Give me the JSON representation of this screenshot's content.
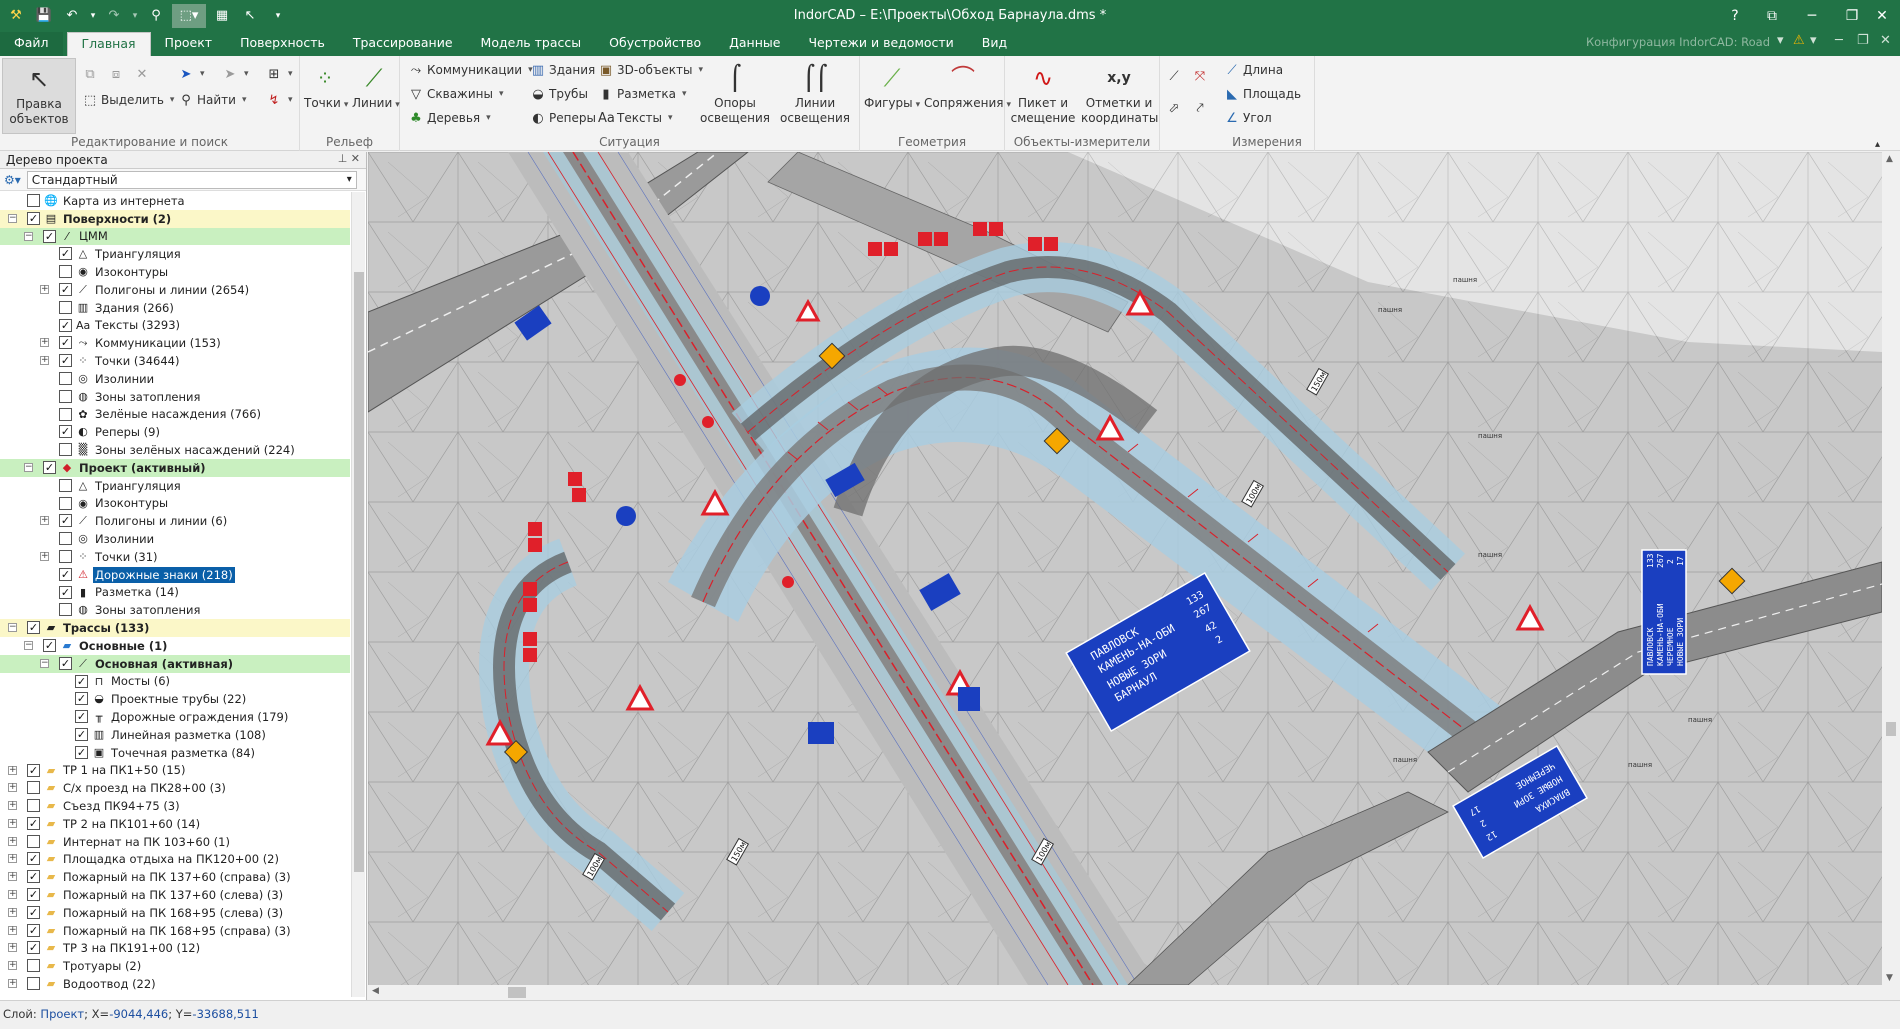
{
  "window": {
    "title": "IndorCAD – E:\\Проекты\\Обход Барнаула.dms *",
    "help": "?",
    "controls": [
      "⧉",
      "─",
      "❐",
      "✕"
    ]
  },
  "quick_access": {
    "icons": [
      "app-logo-icon",
      "save-icon",
      "undo-icon",
      "redo-icon",
      "zoom-tool-icon",
      "select-mode-icon",
      "layout-icon",
      "pointer-icon",
      "customize-icon"
    ]
  },
  "menu": {
    "tabs": [
      "Файл",
      "Главная",
      "Проект",
      "Поверхность",
      "Трассирование",
      "Модель трассы",
      "Обустройство",
      "Данные",
      "Чертежи и ведомости",
      "Вид"
    ],
    "active_tab": "Главная",
    "configuration": "Конфигурация IndorCAD: Road",
    "right_controls": [
      "▾",
      "⚠",
      "▾",
      "─",
      "❐",
      "✕"
    ]
  },
  "ribbon": {
    "groups": [
      {
        "label": "Редактирование и поиск"
      },
      {
        "label": "Рельеф"
      },
      {
        "label": "Ситуация"
      },
      {
        "label": "Геометрия"
      },
      {
        "label": "Объекты-измерители"
      },
      {
        "label": "Измерения"
      }
    ],
    "edit_objects": "Правка объектов",
    "select": "Выделить",
    "find": "Найти",
    "points": "Точки",
    "lines": "Линии",
    "communications": "Коммуникации",
    "wells": "Скважины",
    "trees": "Деревья",
    "buildings": "Здания",
    "pipes": "Трубы",
    "benchmarks": "Реперы",
    "objects_3d": "3D-объекты",
    "marking": "Разметка",
    "texts": "Тексты",
    "lighting_poles": "Опоры освещения",
    "lighting_lines": "Линии освещения",
    "figures": "Фигуры",
    "conjugations": "Сопряжения",
    "picket": "Пикет и смещение",
    "coords": "Отметки и координаты",
    "length": "Длина",
    "area": "Площадь",
    "angle": "Угол"
  },
  "tree_panel": {
    "title": "Дерево проекта",
    "filter": "Стандартный",
    "pin": "⊥ ✕"
  },
  "tree": [
    {
      "label": "Карта из интернета",
      "level": 0,
      "checked": false,
      "icon": "globe-icon",
      "glyph": "🌐"
    },
    {
      "label": "Поверхности (2)",
      "level": 0,
      "checked": true,
      "icon": "surfaces-icon",
      "glyph": "▤",
      "bold": true,
      "hl": "y",
      "exp": "−"
    },
    {
      "label": "ЦММ",
      "level": 1,
      "checked": true,
      "icon": "dtm-icon",
      "glyph": "⁄",
      "hl": "g",
      "exp": "−"
    },
    {
      "label": "Триангуляция",
      "level": 2,
      "checked": true,
      "icon": "triangulation-icon",
      "glyph": "△"
    },
    {
      "label": "Изоконтуры",
      "level": 2,
      "checked": false,
      "icon": "isocontours-icon",
      "glyph": "◉"
    },
    {
      "label": "Полигоны и линии (2654)",
      "level": 2,
      "checked": true,
      "icon": "polygons-icon",
      "glyph": "⟋",
      "exp": "+"
    },
    {
      "label": "Здания (266)",
      "level": 2,
      "checked": false,
      "icon": "buildings-icon",
      "glyph": "▥"
    },
    {
      "label": "Тексты (3293)",
      "level": 2,
      "checked": true,
      "icon": "texts-icon",
      "glyph": "Aa"
    },
    {
      "label": "Коммуникации (153)",
      "level": 2,
      "checked": true,
      "icon": "communications-icon",
      "glyph": "⤳",
      "exp": "+"
    },
    {
      "label": "Точки (34644)",
      "level": 2,
      "checked": true,
      "icon": "points-icon",
      "glyph": "⁘",
      "exp": "+"
    },
    {
      "label": "Изолинии",
      "level": 2,
      "checked": false,
      "icon": "isolines-icon",
      "glyph": "◎"
    },
    {
      "label": "Зоны затопления",
      "level": 2,
      "checked": false,
      "icon": "flood-icon",
      "glyph": "◍"
    },
    {
      "label": "Зелёные насаждения (766)",
      "level": 2,
      "checked": false,
      "icon": "greenery-icon",
      "glyph": "✿"
    },
    {
      "label": "Реперы (9)",
      "level": 2,
      "checked": true,
      "icon": "benchmark-icon",
      "glyph": "◐"
    },
    {
      "label": "Зоны зелёных насаждений (224)",
      "level": 2,
      "checked": false,
      "icon": "green-zones-icon",
      "glyph": "▒"
    },
    {
      "label": "Проект (активный)",
      "level": 1,
      "checked": true,
      "icon": "project-icon",
      "glyph": "◆",
      "bold": true,
      "hl": "g",
      "exp": "−"
    },
    {
      "label": "Триангуляция",
      "level": 2,
      "checked": false,
      "icon": "triangulation-icon",
      "glyph": "△"
    },
    {
      "label": "Изоконтуры",
      "level": 2,
      "checked": false,
      "icon": "isocontours-icon",
      "glyph": "◉"
    },
    {
      "label": "Полигоны и линии (6)",
      "level": 2,
      "checked": true,
      "icon": "polygons-icon",
      "glyph": "⟋",
      "exp": "+"
    },
    {
      "label": "Изолинии",
      "level": 2,
      "checked": false,
      "icon": "isolines-icon",
      "glyph": "◎"
    },
    {
      "label": "Точки (31)",
      "level": 2,
      "checked": false,
      "icon": "points-icon",
      "glyph": "⁘",
      "exp": "+"
    },
    {
      "label": "Дорожные знаки (218)",
      "level": 2,
      "checked": true,
      "icon": "road-signs-icon",
      "glyph": "⚠",
      "sel": true
    },
    {
      "label": "Разметка (14)",
      "level": 2,
      "checked": true,
      "icon": "marking-icon",
      "glyph": "▮"
    },
    {
      "label": "Зоны затопления",
      "level": 2,
      "checked": false,
      "icon": "flood-icon",
      "glyph": "◍"
    },
    {
      "label": "Трассы (133)",
      "level": 0,
      "checked": true,
      "icon": "routes-icon",
      "glyph": "▰",
      "bold": true,
      "hl": "y",
      "exp": "−"
    },
    {
      "label": "Основные (1)",
      "level": 1,
      "checked": true,
      "icon": "folder-blue-icon",
      "glyph": "▰",
      "bold": true,
      "exp": "−"
    },
    {
      "label": "Основная (активная)",
      "level": 2,
      "checked": true,
      "icon": "route-icon",
      "glyph": "⟋",
      "bold": true,
      "hl": "g",
      "exp": "−"
    },
    {
      "label": "Мосты (6)",
      "level": 3,
      "checked": true,
      "icon": "bridge-icon",
      "glyph": "⊓"
    },
    {
      "label": "Проектные трубы (22)",
      "level": 3,
      "checked": true,
      "icon": "pipes-icon",
      "glyph": "◒"
    },
    {
      "label": "Дорожные ограждения (179)",
      "level": 3,
      "checked": true,
      "icon": "barrier-icon",
      "glyph": "╥"
    },
    {
      "label": "Линейная разметка (108)",
      "level": 3,
      "checked": true,
      "icon": "linear-marking-icon",
      "glyph": "▥"
    },
    {
      "label": "Точечная разметка (84)",
      "level": 3,
      "checked": true,
      "icon": "point-marking-icon",
      "glyph": "▣"
    },
    {
      "label": "ТР 1 на ПК1+50 (15)",
      "level": 0,
      "checked": true,
      "icon": "folder-icon",
      "glyph": "▰",
      "exp": "+"
    },
    {
      "label": "С/х проезд на ПК28+00 (3)",
      "level": 0,
      "checked": false,
      "icon": "folder-icon",
      "glyph": "▰",
      "exp": "+"
    },
    {
      "label": "Съезд ПК94+75 (3)",
      "level": 0,
      "checked": false,
      "icon": "folder-icon",
      "glyph": "▰",
      "exp": "+"
    },
    {
      "label": "ТР 2 на ПК101+60 (14)",
      "level": 0,
      "checked": true,
      "icon": "folder-icon",
      "glyph": "▰",
      "exp": "+"
    },
    {
      "label": "Интернат на ПК 103+60 (1)",
      "level": 0,
      "checked": false,
      "icon": "folder-icon",
      "glyph": "▰",
      "exp": "+"
    },
    {
      "label": "Площадка отдыха на ПК120+00 (2)",
      "level": 0,
      "checked": true,
      "icon": "folder-icon",
      "glyph": "▰",
      "exp": "+"
    },
    {
      "label": "Пожарный на ПК 137+60 (справа) (3)",
      "level": 0,
      "checked": true,
      "icon": "folder-icon",
      "glyph": "▰",
      "exp": "+"
    },
    {
      "label": "Пожарный на ПК 137+60 (слева) (3)",
      "level": 0,
      "checked": true,
      "icon": "folder-icon",
      "glyph": "▰",
      "exp": "+"
    },
    {
      "label": "Пожарный на ПК 168+95 (слева) (3)",
      "level": 0,
      "checked": true,
      "icon": "folder-icon",
      "glyph": "▰",
      "exp": "+"
    },
    {
      "label": "Пожарный на ПК 168+95 (справа) (3)",
      "level": 0,
      "checked": true,
      "icon": "folder-icon",
      "glyph": "▰",
      "exp": "+"
    },
    {
      "label": "ТР 3 на ПК191+00 (12)",
      "level": 0,
      "checked": true,
      "icon": "folder-icon",
      "glyph": "▰",
      "exp": "+"
    },
    {
      "label": "Тротуары (2)",
      "level": 0,
      "checked": false,
      "icon": "folder-icon",
      "glyph": "▰",
      "exp": "+"
    },
    {
      "label": "Водоотвод (22)",
      "level": 0,
      "checked": false,
      "icon": "folder-icon",
      "glyph": "▰",
      "exp": "+"
    }
  ],
  "map": {
    "guide_sign_1": [
      "ПАВЛОВСК",
      "КАМЕНЬ-НА-ОБИ",
      "НОВЫЕ ЗОРИ",
      "БАРНАУЛ"
    ],
    "guide_sign_1_nums": [
      "133",
      "267",
      "42",
      "2"
    ],
    "guide_sign_2": [
      "ВЛАСИХА",
      "НОВЫЕ ЗОРИ",
      "ЧЕРЕМНОЕ"
    ],
    "guide_sign_2_nums": [
      "12",
      "2",
      "17"
    ],
    "guide_sign_3": [
      "ПАВЛОВСК",
      "КАМЕНЬ-НА-ОБИ",
      "ЧЕРЕМНОЕ",
      "НОВЫЕ ЗОРИ"
    ],
    "guide_sign_3_nums": [
      "133",
      "267",
      "2",
      "17"
    ],
    "distance_labels": [
      "150м",
      "100м",
      "150м",
      "100м",
      "100м"
    ],
    "land_labels": [
      "пашня",
      "пашня",
      "пашня",
      "пашня",
      "пашня",
      "пашня",
      "пашня"
    ],
    "colors": {
      "terrain": "#c8c8c8",
      "road": "#8f8f8f",
      "route_blue": "#a9cde0",
      "sign_red": "#e0202a",
      "sign_blue": "#1a3fc0",
      "axis_red": "#d9202a"
    }
  },
  "status": {
    "layer_label": "Слой:",
    "layer": "Проект",
    "x_label": "X=",
    "x": "-9044,446",
    "y_label": "Y=",
    "y": "-33688,511"
  }
}
